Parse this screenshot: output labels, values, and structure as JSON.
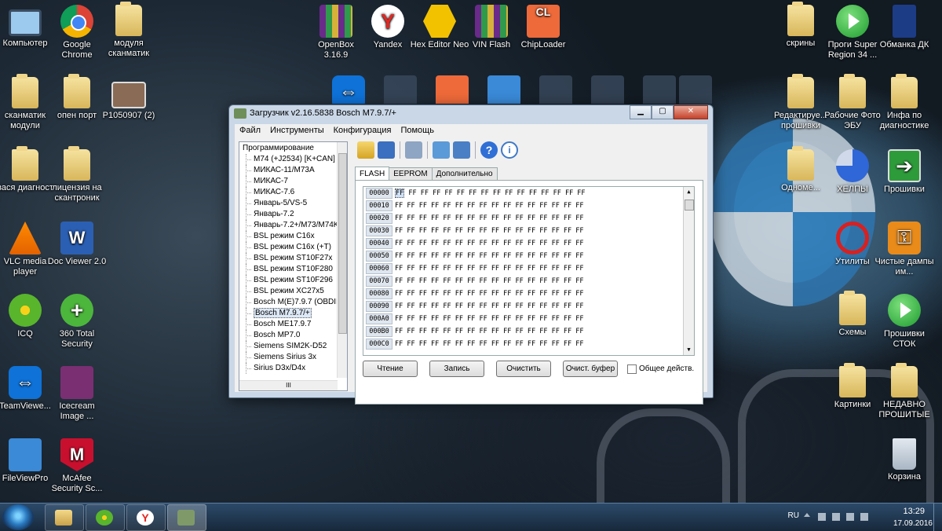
{
  "desktop": {
    "left_icons": [
      {
        "label": "Компьютер",
        "icon": "computer-icon"
      },
      {
        "label": "Google Chrome",
        "icon": "chrome-icon"
      },
      {
        "label": "модуля сканматик",
        "icon": "folder-icon"
      },
      {
        "label": "сканматик модули",
        "icon": "folder-icon"
      },
      {
        "label": "опен порт",
        "icon": "folder-icon"
      },
      {
        "label": "P1050907 (2)",
        "icon": "photo-icon"
      },
      {
        "label": "вася диагност",
        "icon": "folder-icon"
      },
      {
        "label": "лицензия на скантроник",
        "icon": "folder-icon"
      },
      {
        "label": "VLC media player",
        "icon": "vlc-icon"
      },
      {
        "label": "Doc Viewer 2.0",
        "icon": "doc-viewer-icon"
      },
      {
        "label": "ICQ",
        "icon": "icq-icon"
      },
      {
        "label": "360 Total Security",
        "icon": "security-icon"
      },
      {
        "label": "TeamViewe...",
        "icon": "teamviewer-icon"
      },
      {
        "label": "Icecream Image ...",
        "icon": "icecream-icon"
      },
      {
        "label": "FileViewPro",
        "icon": "fileviewpro-icon"
      },
      {
        "label": "McAfee Security Sc...",
        "icon": "mcafee-icon"
      }
    ],
    "top_icons": [
      {
        "label": "OpenBox 3.16.9",
        "icon": "archive-icon"
      },
      {
        "label": "Yandex",
        "icon": "yandex-icon"
      },
      {
        "label": "Hex Editor Neo",
        "icon": "hex-editor-icon"
      },
      {
        "label": "VIN Flash",
        "icon": "archive-icon"
      },
      {
        "label": "ChipLoader",
        "icon": "chiploader-icon"
      }
    ],
    "right_icons": [
      {
        "label": "скрины",
        "icon": "folder-icon"
      },
      {
        "label": "Проги Super Region 34 ...",
        "icon": "play-icon"
      },
      {
        "label": "Обманка ДК",
        "icon": "phone-icon"
      },
      {
        "label": "Редактируе... прошивки",
        "icon": "folder-icon"
      },
      {
        "label": "Рабочие Фото ЭБУ",
        "icon": "folder-icon"
      },
      {
        "label": "Инфа по диагностике",
        "icon": "folder-icon"
      },
      {
        "label": "Одноме...",
        "icon": "folder-icon"
      },
      {
        "label": "ХЕЛПЫ",
        "icon": "pie-icon"
      },
      {
        "label": "Прошивки",
        "icon": "arrow-icon"
      },
      {
        "label": "Утилиты",
        "icon": "no-sign-icon"
      },
      {
        "label": "Чистые дампы им...",
        "icon": "key-icon"
      },
      {
        "label": "Схемы",
        "icon": "folder-icon"
      },
      {
        "label": "Прошивки СТОК",
        "icon": "play-icon"
      },
      {
        "label": "Картинки",
        "icon": "folder-icon"
      },
      {
        "label": "НЕДАВНО ПРОШИТЫЕ",
        "icon": "folder-icon"
      },
      {
        "label": "Корзина",
        "icon": "recycle-bin-icon"
      }
    ]
  },
  "window": {
    "title": "Загрузчик v2.16.5838 Bosch M7.9.7/+",
    "menu": [
      "Файл",
      "Инструменты",
      "Конфигурация",
      "Помощь"
    ],
    "tree": {
      "root": "Программирование",
      "items": [
        "M74 (+J2534) [K+CAN]",
        "МИКАС-11/M73A",
        "МИКАС-7",
        "МИКАС-7.6",
        "Январь-5/VS-5",
        "Январь-7.2",
        "Январь-7.2+/M73/M74K",
        "BSL режим C16x",
        "BSL режим C16x (+T)",
        "BSL режим ST10F27x",
        "BSL режим ST10F280",
        "BSL режим ST10F296",
        "BSL режим XC27x5",
        "Bosch M(E)7.9.7 (OBDII)",
        "Bosch M7.9.7/+",
        "Bosch ME17.9.7",
        "Bosch MP7.0",
        "Siemens SIM2K-D52",
        "Siemens Sirius 3x",
        "Sirius D3x/D4x"
      ],
      "selected": "Bosch M7.9.7/+",
      "hscroll_grip": "III"
    },
    "tabs": [
      "FLASH",
      "EEPROM",
      "Дополнительно"
    ],
    "active_tab": "FLASH",
    "hex": {
      "rows": [
        {
          "addr": "00000",
          "bytes": "FF FF FF FF FF FF FF FF FF FF FF FF FF FF FF FF"
        },
        {
          "addr": "00010",
          "bytes": "FF FF FF FF FF FF FF FF FF FF FF FF FF FF FF FF"
        },
        {
          "addr": "00020",
          "bytes": "FF FF FF FF FF FF FF FF FF FF FF FF FF FF FF FF"
        },
        {
          "addr": "00030",
          "bytes": "FF FF FF FF FF FF FF FF FF FF FF FF FF FF FF FF"
        },
        {
          "addr": "00040",
          "bytes": "FF FF FF FF FF FF FF FF FF FF FF FF FF FF FF FF"
        },
        {
          "addr": "00050",
          "bytes": "FF FF FF FF FF FF FF FF FF FF FF FF FF FF FF FF"
        },
        {
          "addr": "00060",
          "bytes": "FF FF FF FF FF FF FF FF FF FF FF FF FF FF FF FF"
        },
        {
          "addr": "00070",
          "bytes": "FF FF FF FF FF FF FF FF FF FF FF FF FF FF FF FF"
        },
        {
          "addr": "00080",
          "bytes": "FF FF FF FF FF FF FF FF FF FF FF FF FF FF FF FF"
        },
        {
          "addr": "00090",
          "bytes": "FF FF FF FF FF FF FF FF FF FF FF FF FF FF FF FF"
        },
        {
          "addr": "000A0",
          "bytes": "FF FF FF FF FF FF FF FF FF FF FF FF FF FF FF FF"
        },
        {
          "addr": "000B0",
          "bytes": "FF FF FF FF FF FF FF FF FF FF FF FF FF FF FF FF"
        },
        {
          "addr": "000C0",
          "bytes": "FF FF FF FF FF FF FF FF FF FF FF FF FF FF FF FF"
        }
      ],
      "selected_byte": "FF"
    },
    "buttons": {
      "read": "Чтение",
      "write": "Запись",
      "clear": "Очистить",
      "clear_buffer": "Очист. буфер",
      "common_actions": "Общее действ."
    }
  },
  "taskbar": {
    "apps": [
      "explorer-icon",
      "icq-icon",
      "yandex-icon",
      "loader-icon"
    ],
    "lang": "RU",
    "time": "13:29",
    "date": "17.09.2016"
  }
}
